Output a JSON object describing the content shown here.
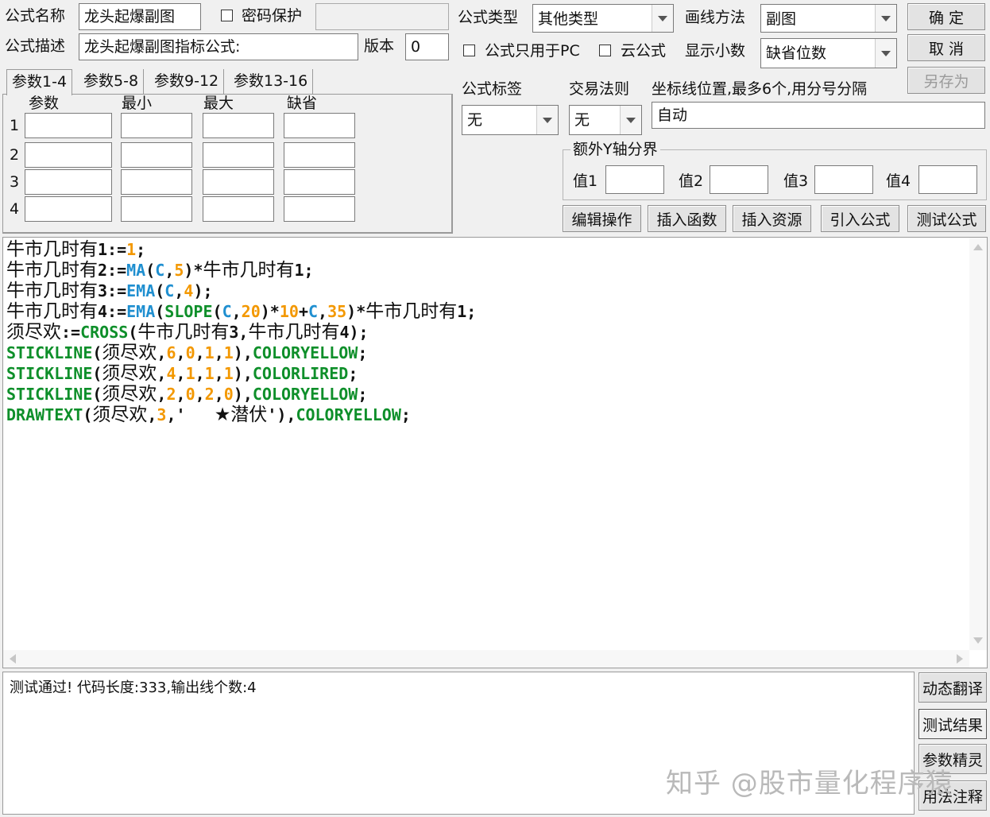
{
  "header": {
    "name_label": "公式名称",
    "name_value": "龙头起爆副图",
    "password_label": "密码保护",
    "desc_label": "公式描述",
    "desc_value": "龙头起爆副图指标公式:",
    "version_label": "版本",
    "version_value": "0",
    "type_label": "公式类型",
    "type_value": "其他类型",
    "draw_label": "画线方法",
    "draw_value": "副图",
    "pc_only_label": "公式只用于PC",
    "cloud_label": "云公式",
    "decimals_label": "显示小数",
    "decimals_value": "缺省位数"
  },
  "buttons": {
    "ok": "确  定",
    "cancel": "取  消",
    "save_as": "另存为",
    "edit_ops": "编辑操作",
    "insert_func": "插入函数",
    "insert_res": "插入资源",
    "import_formula": "引入公式",
    "test_formula": "测试公式",
    "dyn_translate": "动态翻译",
    "test_result": "测试结果",
    "param_wizard": "参数精灵",
    "usage_notes": "用法注释"
  },
  "params": {
    "tabs": [
      "参数1-4",
      "参数5-8",
      "参数9-12",
      "参数13-16"
    ],
    "columns": [
      "参数",
      "最小",
      "最大",
      "缺省"
    ],
    "rows": [
      "1",
      "2",
      "3",
      "4"
    ]
  },
  "right_panel": {
    "tag_label": "公式标签",
    "tag_value": "无",
    "rule_label": "交易法则",
    "rule_value": "无",
    "axis_label": "坐标线位置,最多6个,用分号分隔",
    "axis_value": "自动",
    "yaxis_group": "额外Y轴分界",
    "v1": "值1",
    "v2": "值2",
    "v3": "值3",
    "v4": "值4"
  },
  "code_lines": [
    [
      {
        "t": "牛市几时有",
        "c": "cn"
      },
      {
        "t": "1:=",
        "c": "op"
      },
      {
        "t": "1",
        "c": "num"
      },
      {
        "t": ";",
        "c": "op"
      }
    ],
    [
      {
        "t": "牛市几时有",
        "c": "cn"
      },
      {
        "t": "2:=",
        "c": "op"
      },
      {
        "t": "MA",
        "c": "fn"
      },
      {
        "t": "(",
        "c": "op"
      },
      {
        "t": "C",
        "c": "fn"
      },
      {
        "t": ",",
        "c": "op"
      },
      {
        "t": "5",
        "c": "num"
      },
      {
        "t": ")*",
        "c": "op"
      },
      {
        "t": "牛市几时有",
        "c": "cn"
      },
      {
        "t": "1;",
        "c": "op"
      }
    ],
    [
      {
        "t": "牛市几时有",
        "c": "cn"
      },
      {
        "t": "3:=",
        "c": "op"
      },
      {
        "t": "EMA",
        "c": "fn"
      },
      {
        "t": "(",
        "c": "op"
      },
      {
        "t": "C",
        "c": "fn"
      },
      {
        "t": ",",
        "c": "op"
      },
      {
        "t": "4",
        "c": "num"
      },
      {
        "t": ");",
        "c": "op"
      }
    ],
    [
      {
        "t": "牛市几时有",
        "c": "cn"
      },
      {
        "t": "4:=",
        "c": "op"
      },
      {
        "t": "EMA",
        "c": "fn"
      },
      {
        "t": "(",
        "c": "op"
      },
      {
        "t": "SLOPE",
        "c": "kw"
      },
      {
        "t": "(",
        "c": "op"
      },
      {
        "t": "C",
        "c": "fn"
      },
      {
        "t": ",",
        "c": "op"
      },
      {
        "t": "20",
        "c": "num"
      },
      {
        "t": ")*",
        "c": "op"
      },
      {
        "t": "10",
        "c": "num"
      },
      {
        "t": "+",
        "c": "op"
      },
      {
        "t": "C",
        "c": "fn"
      },
      {
        "t": ",",
        "c": "op"
      },
      {
        "t": "35",
        "c": "num"
      },
      {
        "t": ")*",
        "c": "op"
      },
      {
        "t": "牛市几时有",
        "c": "cn"
      },
      {
        "t": "1;",
        "c": "op"
      }
    ],
    [
      {
        "t": "须尽欢",
        "c": "cn"
      },
      {
        "t": ":=",
        "c": "op"
      },
      {
        "t": "CROSS",
        "c": "kw"
      },
      {
        "t": "(",
        "c": "op"
      },
      {
        "t": "牛市几时有",
        "c": "cn"
      },
      {
        "t": "3,",
        "c": "op"
      },
      {
        "t": "牛市几时有",
        "c": "cn"
      },
      {
        "t": "4);",
        "c": "op"
      }
    ],
    [
      {
        "t": "STICKLINE",
        "c": "kw"
      },
      {
        "t": "(",
        "c": "op"
      },
      {
        "t": "须尽欢",
        "c": "cn"
      },
      {
        "t": ",",
        "c": "op"
      },
      {
        "t": "6",
        "c": "num"
      },
      {
        "t": ",",
        "c": "op"
      },
      {
        "t": "0",
        "c": "num"
      },
      {
        "t": ",",
        "c": "op"
      },
      {
        "t": "1",
        "c": "num"
      },
      {
        "t": ",",
        "c": "op"
      },
      {
        "t": "1",
        "c": "num"
      },
      {
        "t": "),",
        "c": "op"
      },
      {
        "t": "COLORYELLOW",
        "c": "kw"
      },
      {
        "t": ";",
        "c": "op"
      }
    ],
    [
      {
        "t": "STICKLINE",
        "c": "kw"
      },
      {
        "t": "(",
        "c": "op"
      },
      {
        "t": "须尽欢",
        "c": "cn"
      },
      {
        "t": ",",
        "c": "op"
      },
      {
        "t": "4",
        "c": "num"
      },
      {
        "t": ",",
        "c": "op"
      },
      {
        "t": "1",
        "c": "num"
      },
      {
        "t": ",",
        "c": "op"
      },
      {
        "t": "1",
        "c": "num"
      },
      {
        "t": ",",
        "c": "op"
      },
      {
        "t": "1",
        "c": "num"
      },
      {
        "t": "),",
        "c": "op"
      },
      {
        "t": "COLORLIRED",
        "c": "kw"
      },
      {
        "t": ";",
        "c": "op"
      }
    ],
    [
      {
        "t": "STICKLINE",
        "c": "kw"
      },
      {
        "t": "(",
        "c": "op"
      },
      {
        "t": "须尽欢",
        "c": "cn"
      },
      {
        "t": ",",
        "c": "op"
      },
      {
        "t": "2",
        "c": "num"
      },
      {
        "t": ",",
        "c": "op"
      },
      {
        "t": "0",
        "c": "num"
      },
      {
        "t": ",",
        "c": "op"
      },
      {
        "t": "2",
        "c": "num"
      },
      {
        "t": ",",
        "c": "op"
      },
      {
        "t": "0",
        "c": "num"
      },
      {
        "t": "),",
        "c": "op"
      },
      {
        "t": "COLORYELLOW",
        "c": "kw"
      },
      {
        "t": ";",
        "c": "op"
      }
    ],
    [
      {
        "t": "DRAWTEXT",
        "c": "kw"
      },
      {
        "t": "(",
        "c": "op"
      },
      {
        "t": "须尽欢",
        "c": "cn"
      },
      {
        "t": ",",
        "c": "op"
      },
      {
        "t": "3",
        "c": "num"
      },
      {
        "t": ",'   ",
        "c": "op"
      },
      {
        "t": "★潜伏",
        "c": "cn"
      },
      {
        "t": "'),",
        "c": "op"
      },
      {
        "t": "COLORYELLOW",
        "c": "kw"
      },
      {
        "t": ";",
        "c": "op"
      }
    ]
  ],
  "output": {
    "message": "测试通过! 代码长度:333,输出线个数:4"
  },
  "watermark": "知乎 @股市量化程序猿",
  "colors": {
    "keyword": "#0e8f2a",
    "number": "#f39800",
    "function": "#1f8fd0"
  }
}
